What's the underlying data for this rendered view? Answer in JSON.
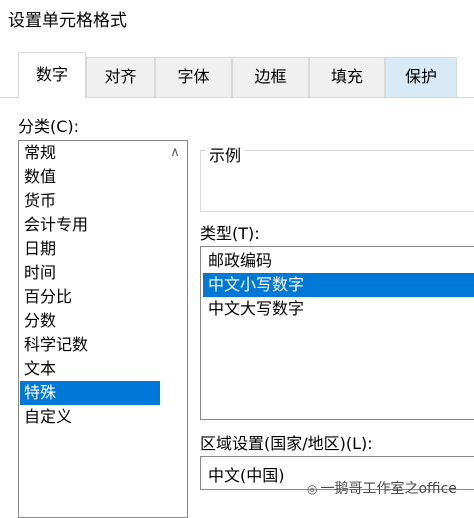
{
  "dialog": {
    "title": "设置单元格格式"
  },
  "tabs": [
    {
      "label": "数字"
    },
    {
      "label": "对齐"
    },
    {
      "label": "字体"
    },
    {
      "label": "边框"
    },
    {
      "label": "填充"
    },
    {
      "label": "保护"
    }
  ],
  "category": {
    "label": "分类(C):",
    "items": [
      "常规",
      "数值",
      "货币",
      "会计专用",
      "日期",
      "时间",
      "百分比",
      "分数",
      "科学记数",
      "文本",
      "特殊",
      "自定义"
    ],
    "selected": "特殊"
  },
  "sample": {
    "label": "示例"
  },
  "type": {
    "label": "类型(T):",
    "items": [
      "邮政编码",
      "中文小写数字",
      "中文大写数字"
    ],
    "selected": "中文小写数字"
  },
  "locale": {
    "label": "区域设置(国家/地区)(L):",
    "value": "中文(中国)"
  },
  "watermark": {
    "icon": "wechat-icon",
    "text": "一鹅哥工作室之office"
  },
  "colors": {
    "selection": "#0078d7",
    "tab_highlight": "#d9eaf7"
  }
}
